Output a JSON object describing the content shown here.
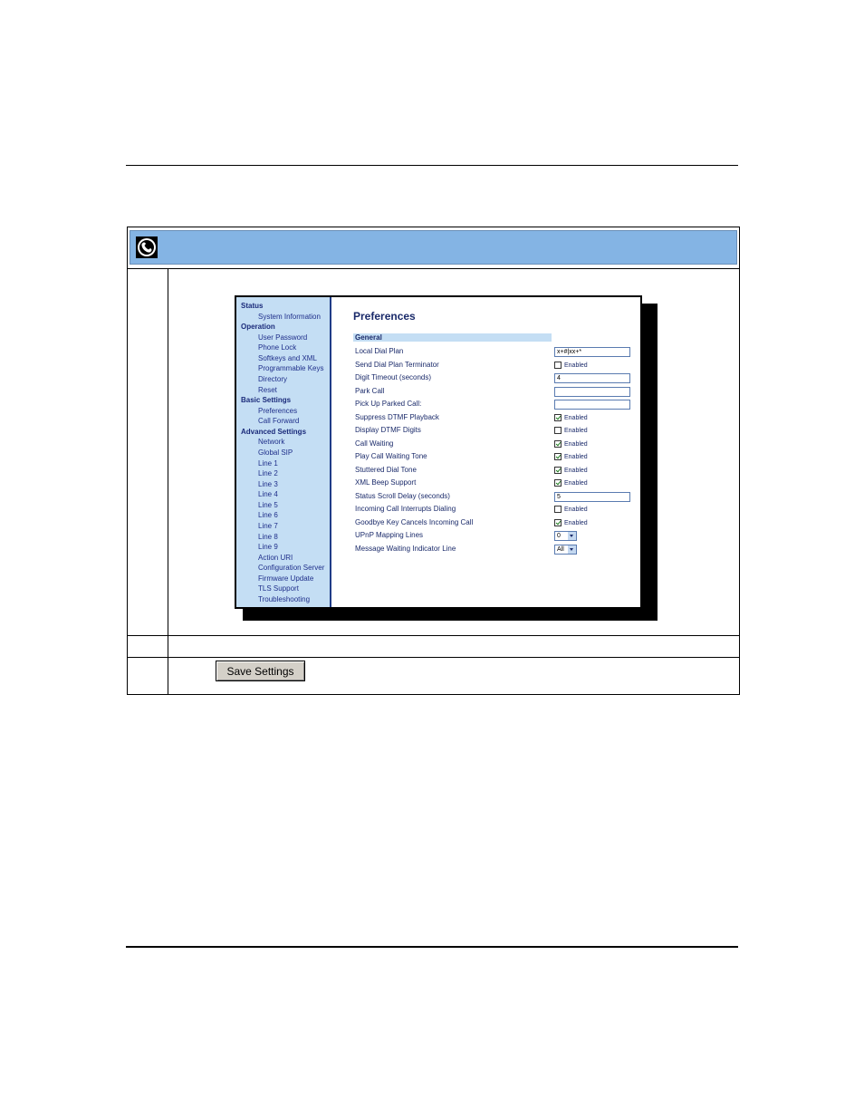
{
  "screenshot": {
    "title": "Preferences",
    "nav": [
      {
        "label": "Status",
        "type": "section"
      },
      {
        "label": "System Information",
        "type": "item"
      },
      {
        "label": "Operation",
        "type": "section"
      },
      {
        "label": "User Password",
        "type": "item"
      },
      {
        "label": "Phone Lock",
        "type": "item"
      },
      {
        "label": "Softkeys and XML",
        "type": "item"
      },
      {
        "label": "Programmable Keys",
        "type": "item"
      },
      {
        "label": "Directory",
        "type": "item"
      },
      {
        "label": "Reset",
        "type": "item"
      },
      {
        "label": "Basic Settings",
        "type": "section"
      },
      {
        "label": "Preferences",
        "type": "item"
      },
      {
        "label": "Call Forward",
        "type": "item"
      },
      {
        "label": "Advanced Settings",
        "type": "section"
      },
      {
        "label": "Network",
        "type": "item"
      },
      {
        "label": "Global SIP",
        "type": "item"
      },
      {
        "label": "Line 1",
        "type": "item"
      },
      {
        "label": "Line 2",
        "type": "item"
      },
      {
        "label": "Line 3",
        "type": "item"
      },
      {
        "label": "Line 4",
        "type": "item"
      },
      {
        "label": "Line 5",
        "type": "item"
      },
      {
        "label": "Line 6",
        "type": "item"
      },
      {
        "label": "Line 7",
        "type": "item"
      },
      {
        "label": "Line 8",
        "type": "item"
      },
      {
        "label": "Line 9",
        "type": "item"
      },
      {
        "label": "Action URI",
        "type": "item"
      },
      {
        "label": "Configuration Server",
        "type": "item"
      },
      {
        "label": "Firmware Update",
        "type": "item"
      },
      {
        "label": "TLS Support",
        "type": "item"
      },
      {
        "label": "Troubleshooting",
        "type": "item"
      }
    ],
    "section_header": "General",
    "settings": [
      {
        "label": "Local Dial Plan",
        "control": "text",
        "value": "x+#|xx+*"
      },
      {
        "label": "Send Dial Plan Terminator",
        "control": "checkbox",
        "checked": false,
        "text": "Enabled"
      },
      {
        "label": "Digit Timeout (seconds)",
        "control": "text",
        "value": "4"
      },
      {
        "label": "Park Call",
        "control": "text",
        "value": ""
      },
      {
        "label": "Pick Up Parked Call:",
        "control": "text",
        "value": ""
      },
      {
        "label": "Suppress DTMF Playback",
        "control": "checkbox",
        "checked": true,
        "text": "Enabled"
      },
      {
        "label": "Display DTMF Digits",
        "control": "checkbox",
        "checked": false,
        "text": "Enabled"
      },
      {
        "label": "Call Waiting",
        "control": "checkbox",
        "checked": true,
        "text": "Enabled"
      },
      {
        "label": "Play Call Waiting Tone",
        "control": "checkbox",
        "checked": true,
        "text": "Enabled"
      },
      {
        "label": "Stuttered Dial Tone",
        "control": "checkbox",
        "checked": true,
        "text": "Enabled"
      },
      {
        "label": "XML Beep Support",
        "control": "checkbox",
        "checked": true,
        "text": "Enabled"
      },
      {
        "label": "Status Scroll Delay (seconds)",
        "control": "text",
        "value": "5"
      },
      {
        "label": "Incoming Call Interrupts Dialing",
        "control": "checkbox",
        "checked": false,
        "text": "Enabled"
      },
      {
        "label": "Goodbye Key Cancels Incoming Call",
        "control": "checkbox",
        "checked": true,
        "text": "Enabled"
      },
      {
        "label": "UPnP Mapping Lines",
        "control": "select",
        "value": "0"
      },
      {
        "label": "Message Waiting Indicator Line",
        "control": "select",
        "value": "All"
      }
    ]
  },
  "save_button_label": "Save Settings",
  "colors": {
    "header_bar": "#84b4e4",
    "sidebar": "#c4def4",
    "sidebar_border": "#1f3c88",
    "link_text": "#1f2f8a"
  },
  "icons": {
    "header": "globe-phone-icon"
  }
}
